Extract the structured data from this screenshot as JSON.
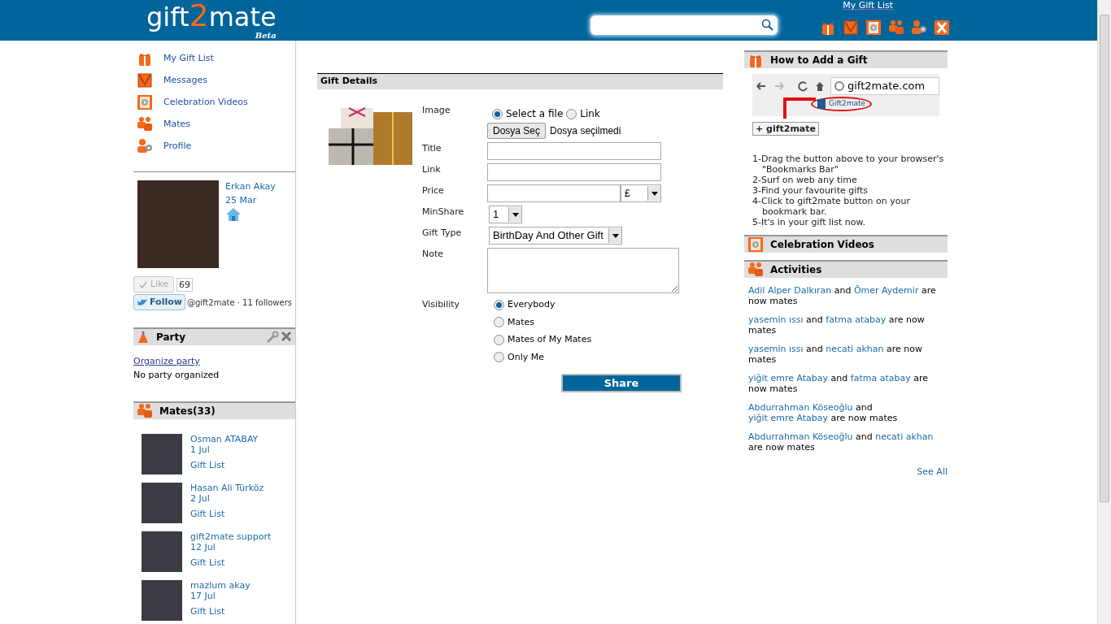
{
  "header": {
    "logo": {
      "part1": "gift",
      "digit": "2",
      "part2": "mate",
      "tag": "Beta"
    },
    "top_link": "My Gift List"
  },
  "sidebar": {
    "nav": [
      {
        "label": "My Gift List"
      },
      {
        "label": "Messages"
      },
      {
        "label": "Celebration Videos"
      },
      {
        "label": "Mates"
      },
      {
        "label": "Profile"
      }
    ],
    "profile": {
      "name": "Erkan Akay",
      "date": "25 Mar"
    },
    "like": {
      "label": "Like",
      "count": "69"
    },
    "follow": {
      "label": "Follow",
      "text": "@gift2mate · 11 followers"
    },
    "party": {
      "title": "Party",
      "link": "Organize party",
      "status": "No party organized"
    },
    "mates": {
      "title": "Mates(33)",
      "items": [
        {
          "name": "Osman ATABAY",
          "date": "1 Jul",
          "link": "Gift List"
        },
        {
          "name": "Hasan Ali Türköz",
          "date": "2 Jul",
          "link": "Gift List"
        },
        {
          "name": "gift2mate support",
          "date": "12 Jul",
          "link": "Gift List"
        },
        {
          "name": "mazlum akay",
          "date": "17 Jul",
          "link": "Gift List"
        }
      ]
    }
  },
  "gift_details": {
    "title": "Gift Details",
    "image": {
      "label": "Image",
      "options": [
        {
          "label": "Select a file",
          "selected": true
        },
        {
          "label": "Link",
          "selected": false
        }
      ],
      "file_button": "Dosya Seç",
      "file_status": "Dosya seçilmedi"
    },
    "title_field": {
      "label": "Title"
    },
    "link_field": {
      "label": "Link"
    },
    "price": {
      "label": "Price",
      "currency": "£"
    },
    "min_share": {
      "label": "MinShare",
      "value": "1"
    },
    "gift_type": {
      "label": "Gift Type",
      "value": "BirthDay And Other Gift"
    },
    "note": {
      "label": "Note"
    },
    "visibility": {
      "label": "Visibility",
      "options": [
        {
          "label": "Everybody",
          "selected": true
        },
        {
          "label": "Mates",
          "selected": false
        },
        {
          "label": "Mates of My Mates",
          "selected": false
        },
        {
          "label": "Only Me",
          "selected": false
        }
      ]
    },
    "share_button": "Share"
  },
  "right": {
    "how_to": {
      "title": "How to Add a Gift",
      "url": "gift2mate.com",
      "bookmark": "Gift2mate",
      "button": "+ gift2mate",
      "steps": [
        "1-Drag the button above to your browser's \"Bookmarks Bar\"",
        "2-Surf on web any time",
        "3-Find your favourite gifts",
        "4-Click to gift2mate button on your bookmark bar.",
        "5-It's in your gift list now."
      ]
    },
    "videos": {
      "title": "Celebration Videos"
    },
    "activities": {
      "title": "Activities",
      "items": [
        {
          "a": "Adil Alper Dalkıran",
          "joiner": "and",
          "b": "Ömer Aydemir",
          "tail": "are now mates"
        },
        {
          "a": "yasemin ıssı",
          "joiner": "and",
          "b": "fatma atabay",
          "tail": "are now mates"
        },
        {
          "a": "yasemin ıssı",
          "joiner": "and",
          "b": "necati akhan",
          "tail": "are now mates"
        },
        {
          "a": "yiğit emre Atabay",
          "joiner": "and",
          "b": "fatma atabay",
          "tail": "are now mates"
        },
        {
          "a": "Abdurrahman Köseoğlu",
          "joiner": "and",
          "b": "yiğit emre Atabay",
          "tail": "are now mates"
        },
        {
          "a": "Abdurrahman Köseoğlu",
          "joiner": "and",
          "b": "necati akhan",
          "tail": "are now mates"
        }
      ],
      "see_all": "See All"
    }
  }
}
